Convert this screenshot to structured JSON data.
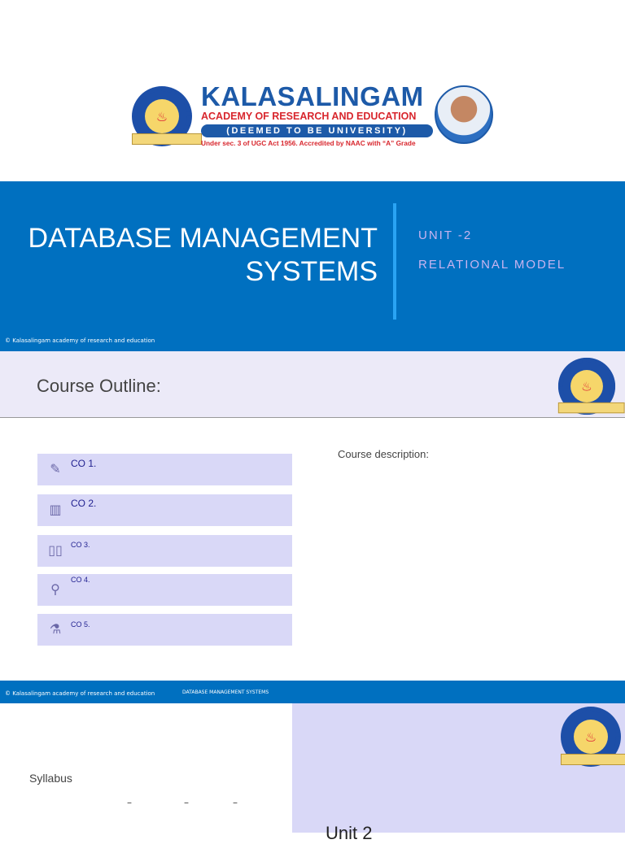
{
  "logo": {
    "name": "KALASALINGAM",
    "subtitle": "ACADEMY OF RESEARCH AND EDUCATION",
    "deemed": "(DEEMED TO BE UNIVERSITY)",
    "accreditation": "Under sec. 3 of UGC Act 1956. Accredited by NAAC with “A” Grade"
  },
  "title_slide": {
    "title_line1": "DATABASE MANAGEMENT",
    "title_line2": "SYSTEMS",
    "unit": "UNIT -2",
    "topic": "RELATIONAL MODEL",
    "copyright": "© Kalasalingam academy of research and education"
  },
  "outline_slide": {
    "heading": "Course Outline:",
    "description_label": "Course description:",
    "items": [
      {
        "label": "CO 1.",
        "icon": "pencil-icon"
      },
      {
        "label": "CO 2.",
        "icon": "beaker-icon"
      },
      {
        "label": "CO 3.",
        "icon": "book-icon"
      },
      {
        "label": "CO 4.",
        "icon": "microscope-icon"
      },
      {
        "label": "CO 5.",
        "icon": "flask-icon"
      }
    ],
    "footer_copyright": "© Kalasalingam academy of research and education",
    "footer_course": "DATABASE MANAGEMENT SYSTEMS"
  },
  "syllabus_slide": {
    "label": "Syllabus",
    "dashes": [
      "–",
      "–",
      "–"
    ],
    "unit_heading": "Unit 2"
  },
  "colors": {
    "brand_blue": "#0070c0",
    "lavender": "#d9d8f7"
  }
}
